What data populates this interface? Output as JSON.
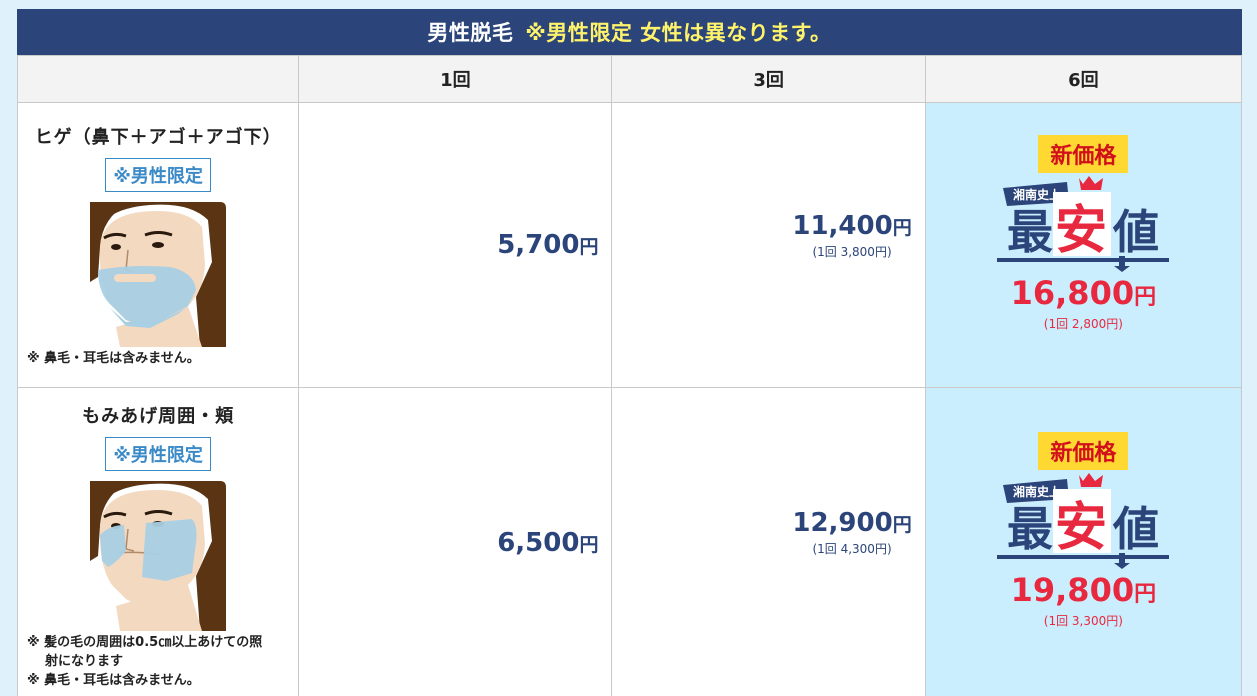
{
  "banner": {
    "title": "男性脱毛",
    "highlight": "※男性限定 女性は異なります。"
  },
  "header": {
    "col1": "1回",
    "col2": "3回",
    "col3": "6回"
  },
  "rows": [
    {
      "name": "ヒゲ（鼻下＋アゴ＋アゴ下）",
      "badge": "※男性限定",
      "notes": [
        "※ 鼻毛・耳毛は含みません。"
      ],
      "price1": "5,700",
      "price3": "11,400",
      "price3_sub": "(1回 3,800円)",
      "tag": "新価格",
      "price6": "16,800",
      "price6_sub": "(1回 2,800円)"
    },
    {
      "name": "もみあげ周囲・頬",
      "badge": "※男性限定",
      "notes": [
        "※ 髪の毛の周囲は0.5㎝以上あけての照",
        "射になります",
        "※ 鼻毛・耳毛は含みません。"
      ],
      "price1": "6,500",
      "price3": "12,900",
      "price3_sub": "(1回 4,300円)",
      "tag": "新価格",
      "price6": "19,800",
      "price6_sub": "(1回 3,300円)"
    }
  ],
  "yen": "円",
  "lowest_badge": {
    "top": "湘南史上",
    "main1": "最",
    "main2": "安",
    "main3": "値"
  },
  "colors": {
    "navy": "#2b4479",
    "red": "#e8283e",
    "yellow": "#ffd832",
    "light_blue": "#cbeefe"
  }
}
